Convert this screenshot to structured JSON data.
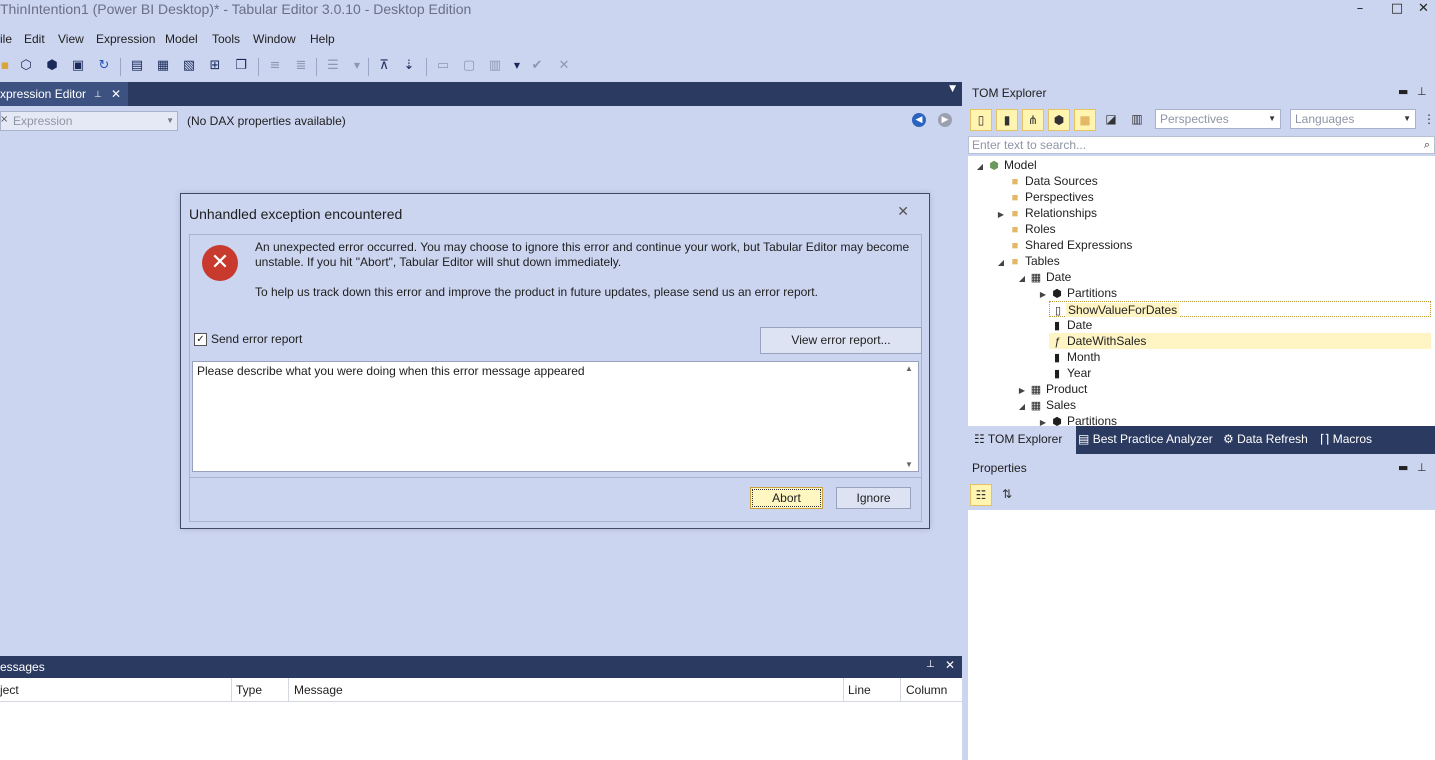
{
  "window": {
    "title": "ThinIntention1 (Power BI Desktop)* - Tabular Editor 3.0.10 - Desktop Edition",
    "minimize": "–",
    "maximize": "□",
    "close": "✕"
  },
  "menu": [
    "ile",
    "Edit",
    "View",
    "Expression",
    "Model",
    "Tools",
    "Window",
    "Help"
  ],
  "expression_editor": {
    "tab_label": "xpression Editor",
    "combo_placeholder": "Expression",
    "no_dax": "(No DAX properties available)"
  },
  "messages": {
    "tab_label": "essages",
    "columns": [
      "ject",
      "Type",
      "Message",
      "Line",
      "Column"
    ]
  },
  "tom_explorer": {
    "title": "TOM Explorer",
    "perspectives_placeholder": "Perspectives",
    "languages_placeholder": "Languages",
    "search_placeholder": "Enter text to search...",
    "tree": [
      "Model",
      "Data Sources",
      "Perspectives",
      "Relationships",
      "Roles",
      "Shared Expressions",
      "Tables",
      "Date",
      "Partitions",
      "ShowValueForDates",
      "Date",
      "DateWithSales",
      "Month",
      "Year",
      "Product",
      "Sales",
      "Partitions"
    ],
    "bottom_tabs": [
      "TOM Explorer",
      "Best Practice Analyzer",
      "Data Refresh",
      "Macros"
    ]
  },
  "properties": {
    "title": "Properties"
  },
  "dialog": {
    "title": "Unhandled exception encountered",
    "message": "An unexpected error occurred. You may choose to ignore this error and continue your work, but Tabular Editor may become unstable. If you hit \"Abort\", Tabular Editor will shut down immediately.",
    "message2": "To help us track down this error and improve the product in future updates, please send us an error report.",
    "send_report_label": "Send error report",
    "send_report_checked": true,
    "view_report_label": "View error report...",
    "description_placeholder": "Please describe what you were doing when this error message appeared",
    "abort_label": "Abort",
    "ignore_label": "Ignore"
  },
  "colors": {
    "chrome": "#ccd5f0",
    "dark_tab": "#2b3a60",
    "error_red": "#c83a2e",
    "selection": "#fff4c4"
  }
}
